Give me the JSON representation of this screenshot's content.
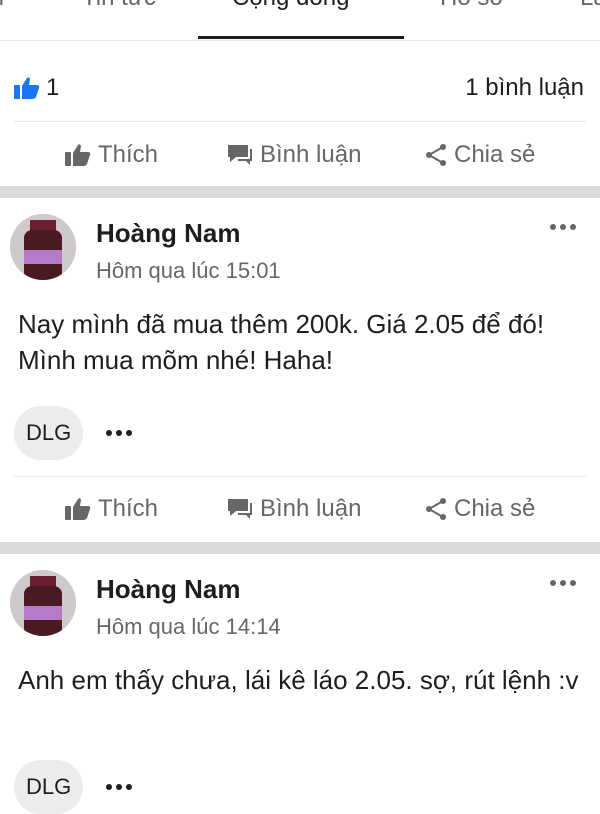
{
  "tabs": [
    {
      "label": "Tin tức",
      "active": false
    },
    {
      "label": "Cộng đồng",
      "active": true
    },
    {
      "label": "Hồ sơ",
      "active": false
    },
    {
      "label": "La",
      "active": false
    }
  ],
  "reactions": {
    "like_count": "1",
    "comment_count": "1 bình luận"
  },
  "actions": {
    "like": "Thích",
    "comment": "Bình luận",
    "share": "Chia sẻ"
  },
  "posts": [
    {
      "author": "Hoàng Nam",
      "time": "Hôm qua lúc 15:01",
      "text": "Nay mình đã mua thêm 200k. Giá 2.05 để đó! Mình mua mõm nhé! Haha!",
      "tag": "DLG"
    },
    {
      "author": "Hoàng Nam",
      "time": "Hôm qua lúc 14:14",
      "text": "Anh em thấy chưa, lái kê láo 2.05. sợ, rút lệnh :v",
      "tag": "DLG"
    }
  ],
  "colors": {
    "accent": "#1877f2",
    "text": "#1c1e21",
    "muted": "#65676b",
    "separator": "#dadada"
  }
}
